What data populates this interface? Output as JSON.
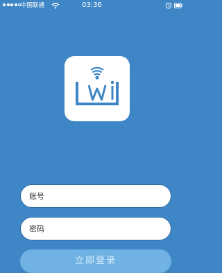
{
  "status_bar": {
    "carrier": "中国联通",
    "time": "03:36",
    "signal_icon": "signal-dots-icon",
    "wifi_icon": "wifi-icon",
    "alarm_icon": "alarm-icon",
    "battery_icon": "battery-icon"
  },
  "logo": {
    "icon": "wi-logo-icon"
  },
  "form": {
    "account_placeholder": "账号",
    "password_placeholder": "密码",
    "login_label": "立即登录"
  },
  "colors": {
    "background": "#3f86c7",
    "logo_blue": "#3f86c7",
    "field_border": "#2a6aa6",
    "button_background": "#6fb2e3"
  }
}
